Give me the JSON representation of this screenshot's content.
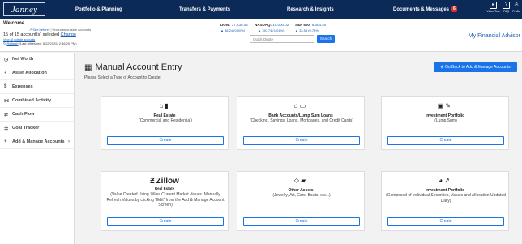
{
  "brand": {
    "logo_text": "Janney"
  },
  "nav": {
    "items": [
      "Portfolio & Planning",
      "Transfers & Payments",
      "Research & Insights",
      "Documents & Messages"
    ],
    "messages_badge": "6",
    "top_icons": [
      {
        "icon": "video-icon",
        "label": "Video Tour"
      },
      {
        "icon": "faq-icon",
        "label": "FAQ"
      },
      {
        "icon": "profile-icon",
        "label": "Profile"
      }
    ]
  },
  "header": {
    "welcome": "Welcome",
    "see_before": "See before",
    "includes_outside": "Includes outside accounts",
    "accounts_selected": "15 of 15 account(s) selected",
    "change_link": "Change",
    "view_all": "View all outside accounts",
    "refresh_link": "Refresh",
    "last_refreshed": "(Last refreshed: 8/22/2025, 2:46:20 PM)",
    "markets": [
      {
        "label": "DOW:",
        "value": "37,236.04",
        "change": "▲ 88.24 (0.00%)"
      },
      {
        "label": "NASDAQ:",
        "value": "10,000.02",
        "change": "▲ 150.74 (1.01%)"
      },
      {
        "label": "S&P 500:",
        "value": "5,304.40",
        "change": "▲ 33.58 (0.73%)"
      }
    ],
    "quote_placeholder": "Quick Quote",
    "search_label": "Search",
    "my_financial_advisor": "My Financial Advisor"
  },
  "sidebar": {
    "items": [
      {
        "label": "Net Worth",
        "icon": "clock-icon"
      },
      {
        "label": "Asset Allocation",
        "icon": "pie-icon"
      },
      {
        "label": "Expenses",
        "icon": "dollar-icon"
      },
      {
        "label": "Combined Activity",
        "icon": "activity-icon"
      },
      {
        "label": "Cash Flow",
        "icon": "cashflow-icon"
      },
      {
        "label": "Goal Tracker",
        "icon": "goal-icon"
      },
      {
        "label": "Add & Manage Accounts",
        "icon": "plus-icon"
      }
    ]
  },
  "main": {
    "title": "Manual Account Entry",
    "subtitle": "Please Select a Type of Account to Create:",
    "back_button": "Go Back to Add & Manage Accounts",
    "cards": [
      {
        "title": "Real Estate",
        "desc": "(Commercial and Residential)",
        "button": "Create",
        "icon": "home-building-icon"
      },
      {
        "title": "Bank Accounts/Lump Sum Loans",
        "desc": "(Checking, Savings, Loans, Mortgages, and Credit Cards)",
        "button": "Create",
        "icon": "bank-card-icon"
      },
      {
        "title": "Investment Portfolio",
        "desc": "(Lump Sum)",
        "button": "Create",
        "icon": "money-edit-icon"
      },
      {
        "title": "Real Estate",
        "desc": "(Value Created Using Zillow Current Market Values. Manually Refresh Values by clicking \"Edit\" from the Add & Manage Account Screen)",
        "button": "Create",
        "icon": "zillow-logo",
        "logo_text": "Zillow"
      },
      {
        "title": "Other Assets",
        "desc": "(Jewelry, Art, Cars, Boats, etc...)",
        "button": "Create",
        "icon": "gem-car-icon"
      },
      {
        "title": "Investment Portfolio",
        "desc": "(Composed of Individual Securities, Values and Allocation Updated Daily)",
        "button": "Create",
        "icon": "pie-chart-line-icon"
      }
    ]
  }
}
